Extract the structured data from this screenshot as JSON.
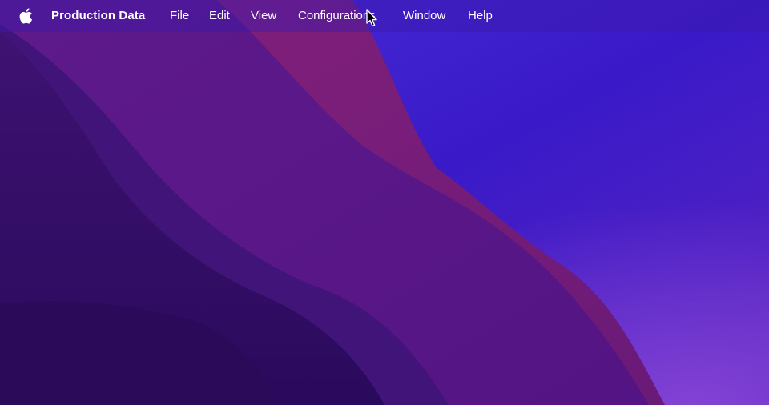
{
  "menubar": {
    "apple_icon": "apple-logo-icon",
    "app_name": "Production Data",
    "items": [
      {
        "label": "File"
      },
      {
        "label": "Edit"
      },
      {
        "label": "View"
      },
      {
        "label": "Configurations"
      },
      {
        "label": "Window"
      },
      {
        "label": "Help"
      }
    ]
  },
  "colors": {
    "menubar_bg": "#3c18aa",
    "wallpaper_blue": "#3a1fc8",
    "wallpaper_purple": "#5a1490",
    "wallpaper_magenta": "#7a2070",
    "wallpaper_dark": "#2c0c62"
  },
  "cursor": {
    "icon": "arrow-pointer-icon"
  }
}
